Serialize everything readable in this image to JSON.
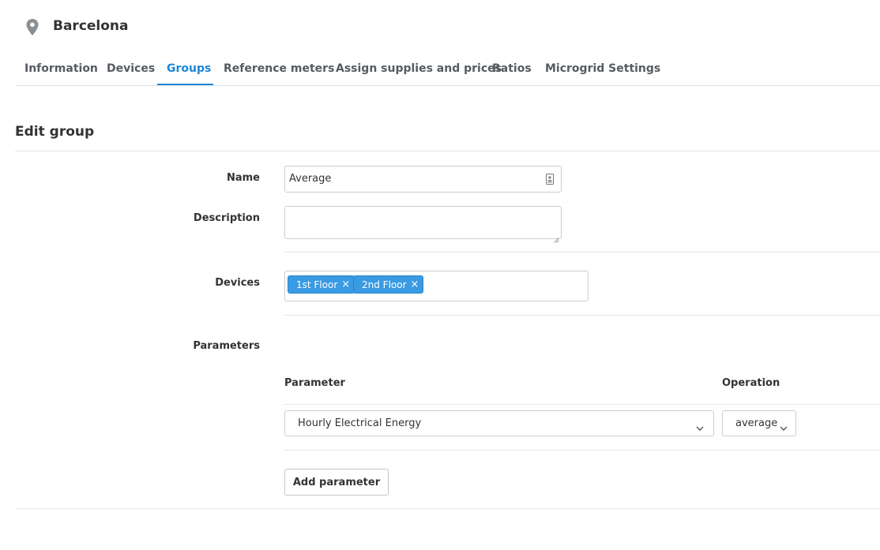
{
  "header": {
    "icon": "location-pin-icon",
    "title": "Barcelona"
  },
  "tabs": [
    {
      "label": "Information",
      "active": false
    },
    {
      "label": "Devices",
      "active": false
    },
    {
      "label": "Groups",
      "active": true
    },
    {
      "label": "Reference meters",
      "active": false
    },
    {
      "label": "Assign supplies and prices",
      "active": false
    },
    {
      "label": "Ratios",
      "active": false
    },
    {
      "label": "Microgrid Settings",
      "active": false
    }
  ],
  "accent_color": "#1b87d9",
  "chip_color": "#3a9be3",
  "form": {
    "title": "Edit group",
    "name_label": "Name",
    "name_value": "Average",
    "description_label": "Description",
    "description_value": "",
    "devices_label": "Devices",
    "devices": [
      {
        "label": "1st Floor",
        "remove": "×"
      },
      {
        "label": "2nd Floor",
        "remove": "×"
      }
    ],
    "parameters_label": "Parameters",
    "parameters_table": {
      "col_parameter": "Parameter",
      "col_operation": "Operation",
      "rows": [
        {
          "parameter": "Hourly Electrical Energy",
          "operation": "average"
        }
      ]
    },
    "add_parameter_label": "Add parameter"
  }
}
